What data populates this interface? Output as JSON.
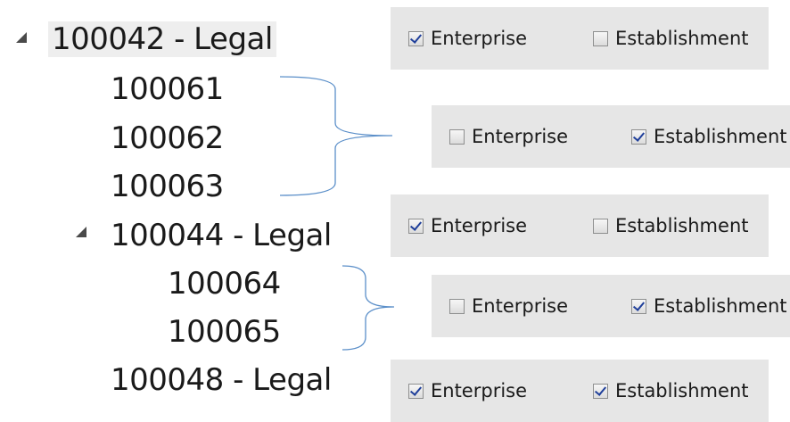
{
  "tree": {
    "nodes": [
      {
        "label": "100042 - Legal"
      },
      {
        "label": "100061"
      },
      {
        "label": "100062"
      },
      {
        "label": "100063"
      },
      {
        "label": "100044 - Legal"
      },
      {
        "label": "100064"
      },
      {
        "label": "100065"
      },
      {
        "label": "100048 - Legal"
      }
    ],
    "icons": {
      "expanded": "expanded-triangle-icon"
    }
  },
  "panels": [
    {
      "options": [
        {
          "label": "Enterprise",
          "checked": true
        },
        {
          "label": "Establishment",
          "checked": false
        }
      ]
    },
    {
      "options": [
        {
          "label": "Enterprise",
          "checked": false
        },
        {
          "label": "Establishment",
          "checked": true
        }
      ]
    },
    {
      "options": [
        {
          "label": "Enterprise",
          "checked": true
        },
        {
          "label": "Establishment",
          "checked": false
        }
      ]
    },
    {
      "options": [
        {
          "label": "Enterprise",
          "checked": false
        },
        {
          "label": "Establishment",
          "checked": true
        }
      ]
    },
    {
      "options": [
        {
          "label": "Enterprise",
          "checked": true
        },
        {
          "label": "Establishment",
          "checked": true
        }
      ]
    }
  ],
  "colors": {
    "bracket": "#5b8fc9",
    "panel_bg": "#e6e6e6",
    "selected_bg": "#eeeeee",
    "check": "#1f3f9a"
  }
}
